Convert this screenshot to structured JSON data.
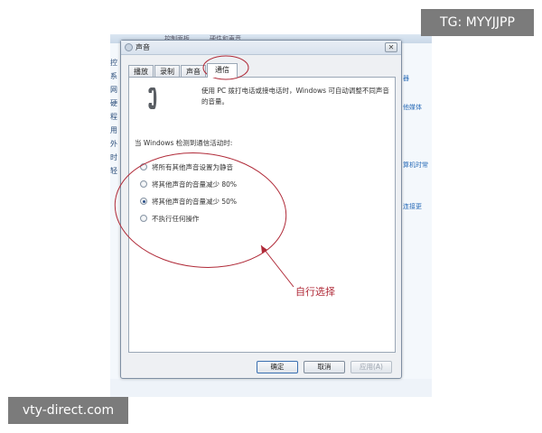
{
  "background": {
    "address_bar": [
      "控制面板",
      "硬件和声音"
    ],
    "left_items": [
      "控",
      "系",
      "网",
      "硬",
      "程",
      "用",
      "外",
      "时",
      "轻"
    ],
    "right_links": [
      "器",
      "他媒体",
      "算机时常",
      "连接更"
    ]
  },
  "dialog": {
    "title": "声音",
    "close_label": "✕",
    "tabs": [
      {
        "label": "播放"
      },
      {
        "label": "录制"
      },
      {
        "label": "声音"
      },
      {
        "label": "通信"
      }
    ],
    "active_tab": "通信",
    "description": "使用 PC 拨打电话或接电话时，Windows 可自动调整不同声音的音量。",
    "group_label": "当 Windows 检测到通信活动时:",
    "options": [
      {
        "label": "将所有其他声音设置为静音",
        "checked": false
      },
      {
        "label": "将其他声音的音量减少 80%",
        "checked": false
      },
      {
        "label": "将其他声音的音量减少 50%",
        "checked": true
      },
      {
        "label": "不执行任何操作",
        "checked": false
      }
    ],
    "buttons": {
      "ok": "确定",
      "cancel": "取消",
      "apply": "应用(A)"
    }
  },
  "annotation": {
    "text": "自行选择",
    "color": "#b02a38"
  },
  "watermarks": {
    "top_right": "TG: MYYJJPP",
    "bottom_left": "vty-direct.com"
  }
}
